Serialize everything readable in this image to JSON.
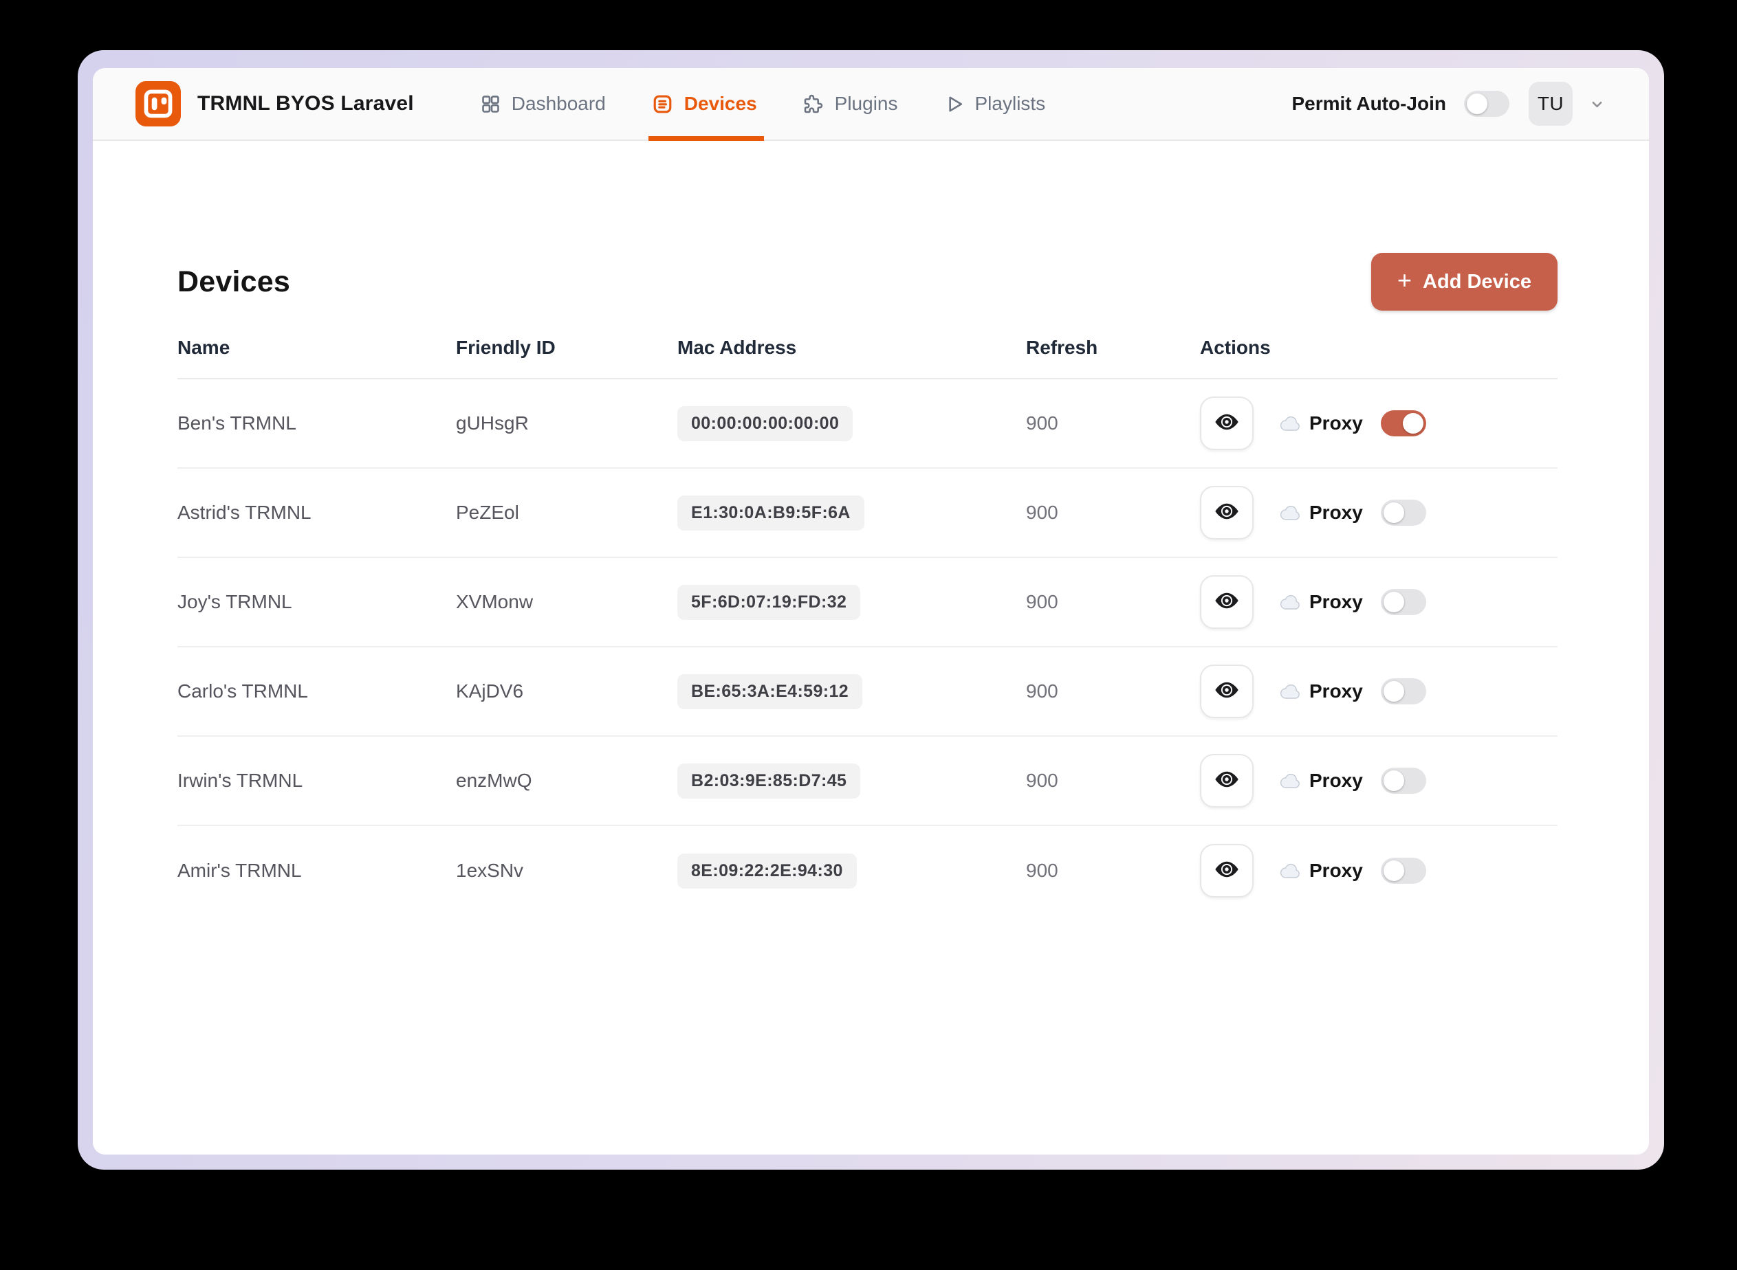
{
  "header": {
    "app_title": "TRMNL BYOS Laravel",
    "nav": [
      {
        "label": "Dashboard",
        "icon": "grid-icon",
        "active": false
      },
      {
        "label": "Devices",
        "icon": "list-icon",
        "active": true
      },
      {
        "label": "Plugins",
        "icon": "puzzle-icon",
        "active": false
      },
      {
        "label": "Playlists",
        "icon": "play-icon",
        "active": false
      }
    ],
    "permit_auto_join_label": "Permit Auto-Join",
    "permit_auto_join_enabled": false,
    "avatar_initials": "TU"
  },
  "page": {
    "title": "Devices",
    "add_device_plus": "+",
    "add_device_label": "Add Device"
  },
  "table": {
    "columns": [
      "Name",
      "Friendly ID",
      "Mac Address",
      "Refresh",
      "Actions"
    ],
    "proxy_label": "Proxy",
    "rows": [
      {
        "name": "Ben's TRMNL",
        "friendly_id": "gUHsgR",
        "mac": "00:00:00:00:00:00",
        "refresh": "900",
        "proxy_enabled": true
      },
      {
        "name": "Astrid's TRMNL",
        "friendly_id": "PeZEol",
        "mac": "E1:30:0A:B9:5F:6A",
        "refresh": "900",
        "proxy_enabled": false
      },
      {
        "name": "Joy's TRMNL",
        "friendly_id": "XVMonw",
        "mac": "5F:6D:07:19:FD:32",
        "refresh": "900",
        "proxy_enabled": false
      },
      {
        "name": "Carlo's TRMNL",
        "friendly_id": "KAjDV6",
        "mac": "BE:65:3A:E4:59:12",
        "refresh": "900",
        "proxy_enabled": false
      },
      {
        "name": "Irwin's TRMNL",
        "friendly_id": "enzMwQ",
        "mac": "B2:03:9E:85:D7:45",
        "refresh": "900",
        "proxy_enabled": false
      },
      {
        "name": "Amir's TRMNL",
        "friendly_id": "1exSNv",
        "mac": "8E:09:22:2E:94:30",
        "refresh": "900",
        "proxy_enabled": false
      }
    ]
  },
  "colors": {
    "brand_orange": "#E8590C",
    "accent_terracotta": "#C7604A",
    "toggle_off": "#E4E4E7",
    "header_bg": "#FAFAFA",
    "frame_gradient_start": "#D5D2EE",
    "frame_gradient_end": "#EDE4EC"
  }
}
